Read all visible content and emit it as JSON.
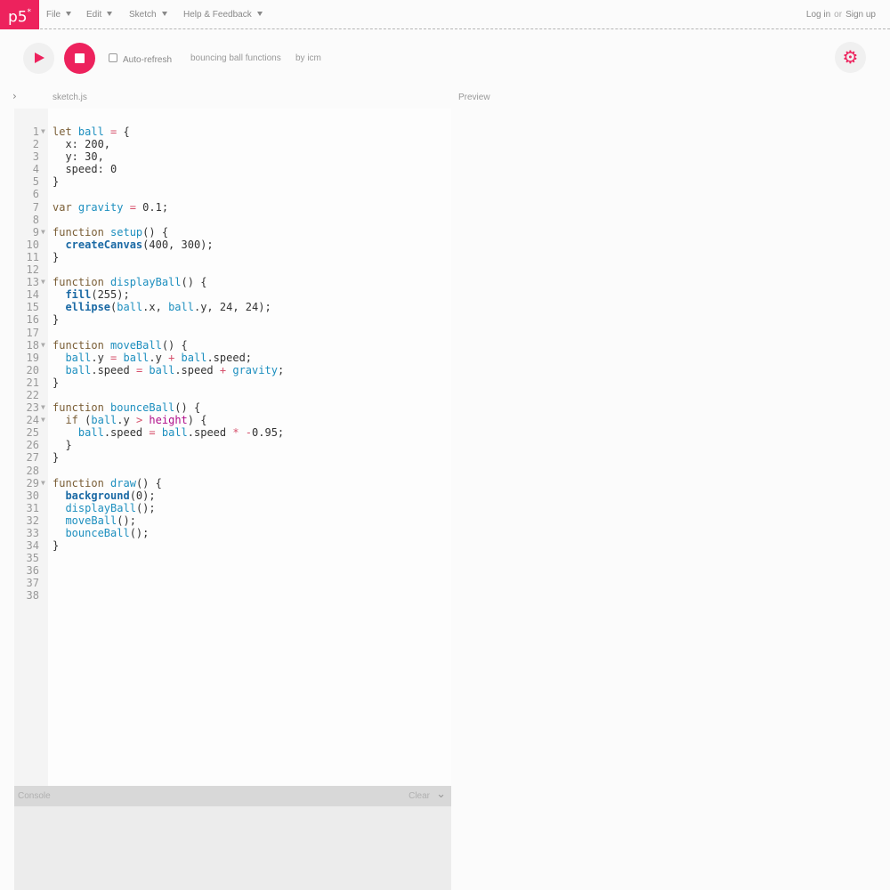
{
  "logo": "p5*",
  "menu": [
    {
      "label": "File"
    },
    {
      "label": "Edit"
    },
    {
      "label": "Sketch"
    },
    {
      "label": "Help & Feedback"
    }
  ],
  "auth": {
    "login": "Log in",
    "or": "or",
    "signup": "Sign up"
  },
  "toolbar": {
    "autorefresh_label": "Auto-refresh",
    "autorefresh_checked": false,
    "sketch_name": "bouncing ball functions",
    "owner": "by icm"
  },
  "editor": {
    "file_tab": "sketch.js",
    "preview_label": "Preview"
  },
  "console": {
    "label": "Console",
    "clear": "Clear"
  },
  "code_lines": [
    {
      "n": "1",
      "fold": true
    },
    {
      "n": "2"
    },
    {
      "n": "3"
    },
    {
      "n": "4"
    },
    {
      "n": "5"
    },
    {
      "n": "6"
    },
    {
      "n": "7"
    },
    {
      "n": "8"
    },
    {
      "n": "9",
      "fold": true
    },
    {
      "n": "10"
    },
    {
      "n": "11"
    },
    {
      "n": "12"
    },
    {
      "n": "13",
      "fold": true
    },
    {
      "n": "14"
    },
    {
      "n": "15"
    },
    {
      "n": "16"
    },
    {
      "n": "17"
    },
    {
      "n": "18",
      "fold": true
    },
    {
      "n": "19"
    },
    {
      "n": "20"
    },
    {
      "n": "21"
    },
    {
      "n": "22"
    },
    {
      "n": "23",
      "fold": true
    },
    {
      "n": "24",
      "fold": true
    },
    {
      "n": "25"
    },
    {
      "n": "26"
    },
    {
      "n": "27"
    },
    {
      "n": "28"
    },
    {
      "n": "29",
      "fold": true
    },
    {
      "n": "30"
    },
    {
      "n": "31"
    },
    {
      "n": "32"
    },
    {
      "n": "33"
    },
    {
      "n": "34"
    },
    {
      "n": "35"
    },
    {
      "n": "36"
    },
    {
      "n": "37"
    },
    {
      "n": "38"
    }
  ],
  "code_tokens": [
    [
      [
        "k",
        "let "
      ],
      [
        "v",
        "ball"
      ],
      [
        "o",
        " = "
      ],
      [
        "n",
        "{"
      ]
    ],
    [
      [
        "n",
        "  x: 200,"
      ]
    ],
    [
      [
        "n",
        "  y: 30,"
      ]
    ],
    [
      [
        "n",
        "  speed: 0"
      ]
    ],
    [
      [
        "n",
        "}"
      ]
    ],
    [],
    [
      [
        "k",
        "var "
      ],
      [
        "v",
        "gravity"
      ],
      [
        "o",
        " = "
      ],
      [
        "n",
        "0.1;"
      ]
    ],
    [],
    [
      [
        "k",
        "function "
      ],
      [
        "f",
        "setup"
      ],
      [
        "n",
        "() {"
      ]
    ],
    [
      [
        "n",
        "  "
      ],
      [
        "b",
        "createCanvas"
      ],
      [
        "n",
        "(400, 300);"
      ]
    ],
    [
      [
        "n",
        "}"
      ]
    ],
    [],
    [
      [
        "k",
        "function "
      ],
      [
        "f",
        "displayBall"
      ],
      [
        "n",
        "() {"
      ]
    ],
    [
      [
        "n",
        "  "
      ],
      [
        "b",
        "fill"
      ],
      [
        "n",
        "(255);"
      ]
    ],
    [
      [
        "n",
        "  "
      ],
      [
        "b",
        "ellipse"
      ],
      [
        "n",
        "("
      ],
      [
        "v",
        "ball"
      ],
      [
        "n",
        ".x, "
      ],
      [
        "v",
        "ball"
      ],
      [
        "n",
        ".y, 24, 24);"
      ]
    ],
    [
      [
        "n",
        "}"
      ]
    ],
    [],
    [
      [
        "k",
        "function "
      ],
      [
        "f",
        "moveBall"
      ],
      [
        "n",
        "() {"
      ]
    ],
    [
      [
        "n",
        "  "
      ],
      [
        "v",
        "ball"
      ],
      [
        "n",
        ".y"
      ],
      [
        "o",
        " = "
      ],
      [
        "v",
        "ball"
      ],
      [
        "n",
        ".y"
      ],
      [
        "o",
        " + "
      ],
      [
        "v",
        "ball"
      ],
      [
        "n",
        ".speed;"
      ]
    ],
    [
      [
        "n",
        "  "
      ],
      [
        "v",
        "ball"
      ],
      [
        "n",
        ".speed"
      ],
      [
        "o",
        " = "
      ],
      [
        "v",
        "ball"
      ],
      [
        "n",
        ".speed"
      ],
      [
        "o",
        " + "
      ],
      [
        "v",
        "gravity"
      ],
      [
        "n",
        ";"
      ]
    ],
    [
      [
        "n",
        "}"
      ]
    ],
    [],
    [
      [
        "k",
        "function "
      ],
      [
        "f",
        "bounceBall"
      ],
      [
        "n",
        "() {"
      ]
    ],
    [
      [
        "n",
        "  "
      ],
      [
        "k",
        "if "
      ],
      [
        "n",
        "("
      ],
      [
        "v",
        "ball"
      ],
      [
        "n",
        ".y"
      ],
      [
        "o",
        " > "
      ],
      [
        "m",
        "height"
      ],
      [
        "n",
        ") {"
      ]
    ],
    [
      [
        "n",
        "    "
      ],
      [
        "v",
        "ball"
      ],
      [
        "n",
        ".speed"
      ],
      [
        "o",
        " = "
      ],
      [
        "v",
        "ball"
      ],
      [
        "n",
        ".speed"
      ],
      [
        "o",
        " * -"
      ],
      [
        "n",
        "0.95;"
      ]
    ],
    [
      [
        "n",
        "  }"
      ]
    ],
    [
      [
        "n",
        "}"
      ]
    ],
    [],
    [
      [
        "k",
        "function "
      ],
      [
        "f",
        "draw"
      ],
      [
        "n",
        "() {"
      ]
    ],
    [
      [
        "n",
        "  "
      ],
      [
        "b",
        "background"
      ],
      [
        "n",
        "(0);"
      ]
    ],
    [
      [
        "n",
        "  "
      ],
      [
        "f",
        "displayBall"
      ],
      [
        "n",
        "();"
      ]
    ],
    [
      [
        "n",
        "  "
      ],
      [
        "f",
        "moveBall"
      ],
      [
        "n",
        "();"
      ]
    ],
    [
      [
        "n",
        "  "
      ],
      [
        "f",
        "bounceBall"
      ],
      [
        "n",
        "();"
      ]
    ],
    [
      [
        "n",
        "}"
      ]
    ],
    [],
    [],
    [],
    []
  ],
  "icons": {
    "play": "play-icon",
    "stop": "stop-icon",
    "settings": "gear-icon",
    "sidebar_toggle": "chevron-right-icon",
    "console_toggle": "chevron-down-icon"
  },
  "colors": {
    "accent": "#ed225d"
  }
}
